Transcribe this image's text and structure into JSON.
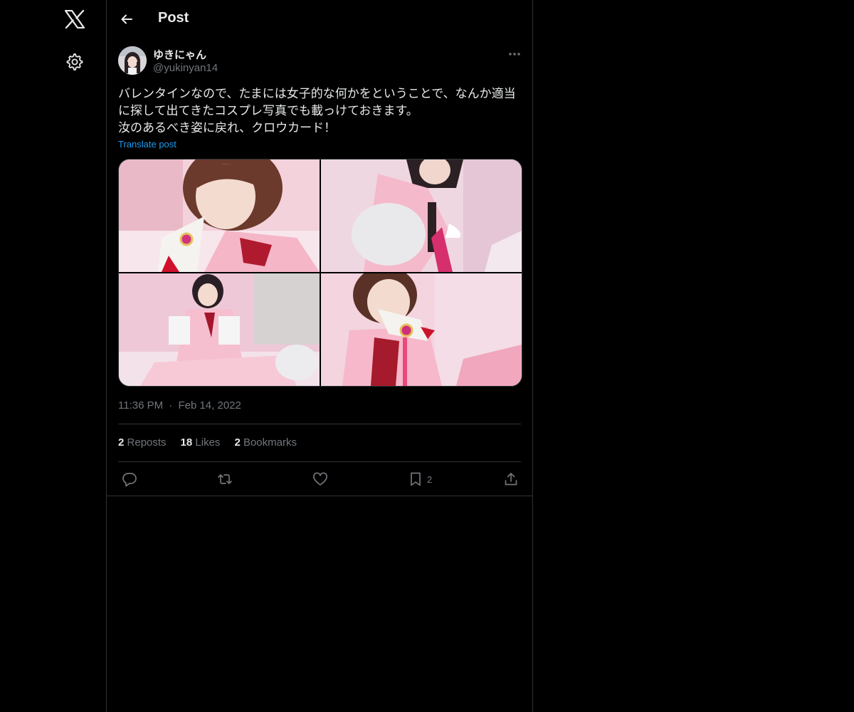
{
  "nav": {
    "logo_icon": "x-logo-icon",
    "settings_icon": "gear-icon"
  },
  "header": {
    "title": "Post",
    "back_icon": "arrow-left-icon"
  },
  "post": {
    "author": {
      "display_name": "ゆきにゃん",
      "handle": "@yukinyan14"
    },
    "text": "バレンタインなので、たまには女子的な何かをということで、なんか適当\nに探して出てきたコスプレ写真でも載っけておきます。\n汝のあるべき姿に戻れ、クロウカード！",
    "translate_label": "Translate post",
    "media_count": 4,
    "timestamp": {
      "time": "11:36 PM",
      "separator": "·",
      "date": "Feb 14, 2022"
    },
    "stats": {
      "reposts_count": "2",
      "reposts_label": "Reposts",
      "likes_count": "18",
      "likes_label": "Likes",
      "bookmarks_count": "2",
      "bookmarks_label": "Bookmarks"
    },
    "actions": {
      "reply_icon": "reply-icon",
      "repost_icon": "repost-icon",
      "like_icon": "heart-icon",
      "bookmark_icon": "bookmark-icon",
      "bookmark_count": "2",
      "share_icon": "share-icon"
    }
  },
  "colors": {
    "background": "#000000",
    "text": "#e7e9ea",
    "muted": "#71767b",
    "accent": "#1d9bf0",
    "border": "#2f3336"
  }
}
